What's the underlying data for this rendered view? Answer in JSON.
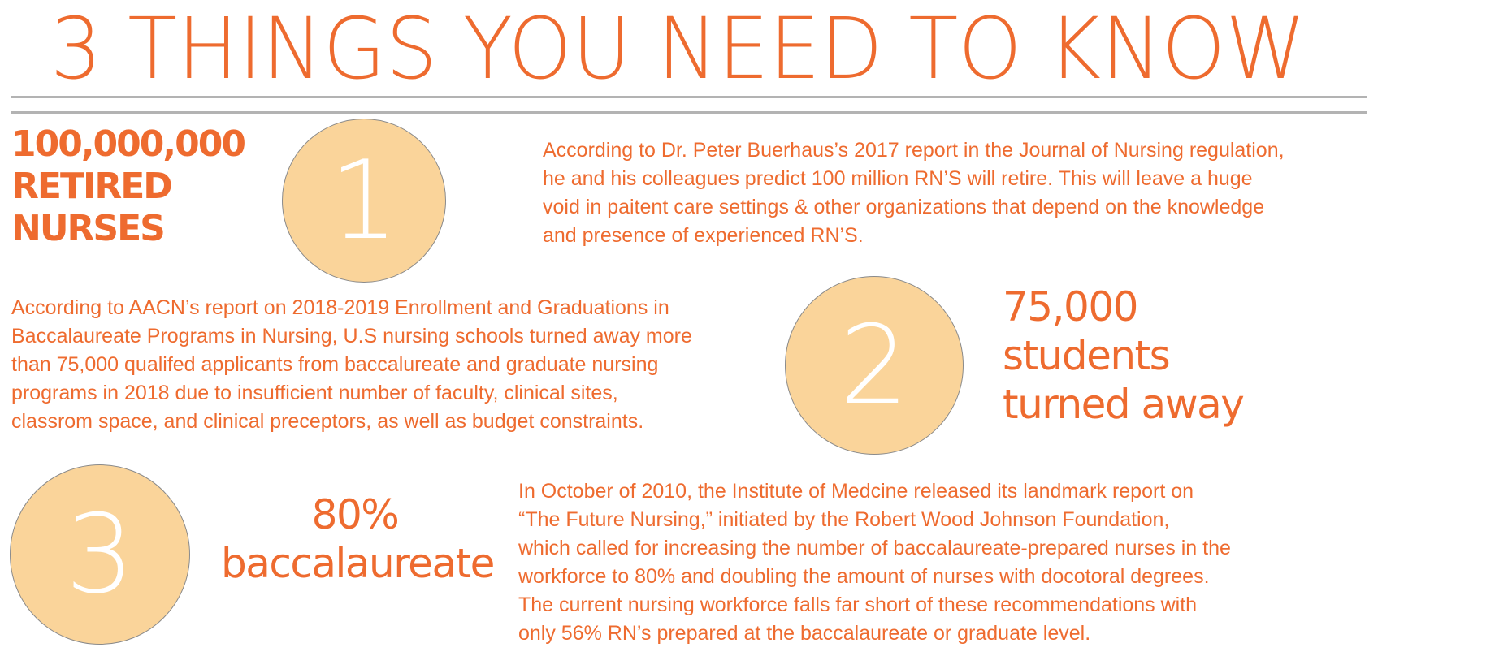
{
  "title": "3 THINGS YOU NEED TO KNOW",
  "colors": {
    "text": "#ee6b2f",
    "circle_fill": "#fad49a",
    "rule": "#b3b3b3"
  },
  "items": [
    {
      "number": "1",
      "stat_lines": [
        "100,000,000",
        "RETIRED",
        "NURSES"
      ],
      "paragraph_lines": [
        "According to Dr. Peter Buerhaus’s 2017 report in the Journal of Nursing regulation,",
        "he and his colleagues predict 100 million RN’S will retire. This will leave a huge",
        "void in paitent care settings & other organizations that depend on the knowledge",
        "and presence of experienced RN’S."
      ]
    },
    {
      "number": "2",
      "stat_lines": [
        "75,000",
        "students",
        "turned away"
      ],
      "paragraph_lines": [
        "According to AACN’s report on 2018-2019 Enrollment and Graduations in",
        "Baccalaureate Programs in Nursing, U.S nursing schools turned away more",
        "than 75,000 qualifed  applicants from baccalureate and graduate nursing",
        "programs in 2018 due to insufficient number of faculty, clinical sites,",
        "classrom space, and clinical preceptors, as well as budget constraints."
      ]
    },
    {
      "number": "3",
      "stat_lines": [
        "80%",
        "baccalaureate"
      ],
      "paragraph_lines": [
        "In October of 2010, the Institute of Medcine released its landmark report on",
        "“The Future Nursing,” initiated by the Robert Wood Johnson Foundation,",
        "which called for increasing the number of baccalaureate-prepared nurses in the",
        "workforce to 80% and doubling the amount of nurses with docotoral degrees.",
        "The current nursing workforce falls far short of these recommendations with",
        "only 56% RN’s prepared at the baccalaureate or graduate level."
      ]
    }
  ]
}
